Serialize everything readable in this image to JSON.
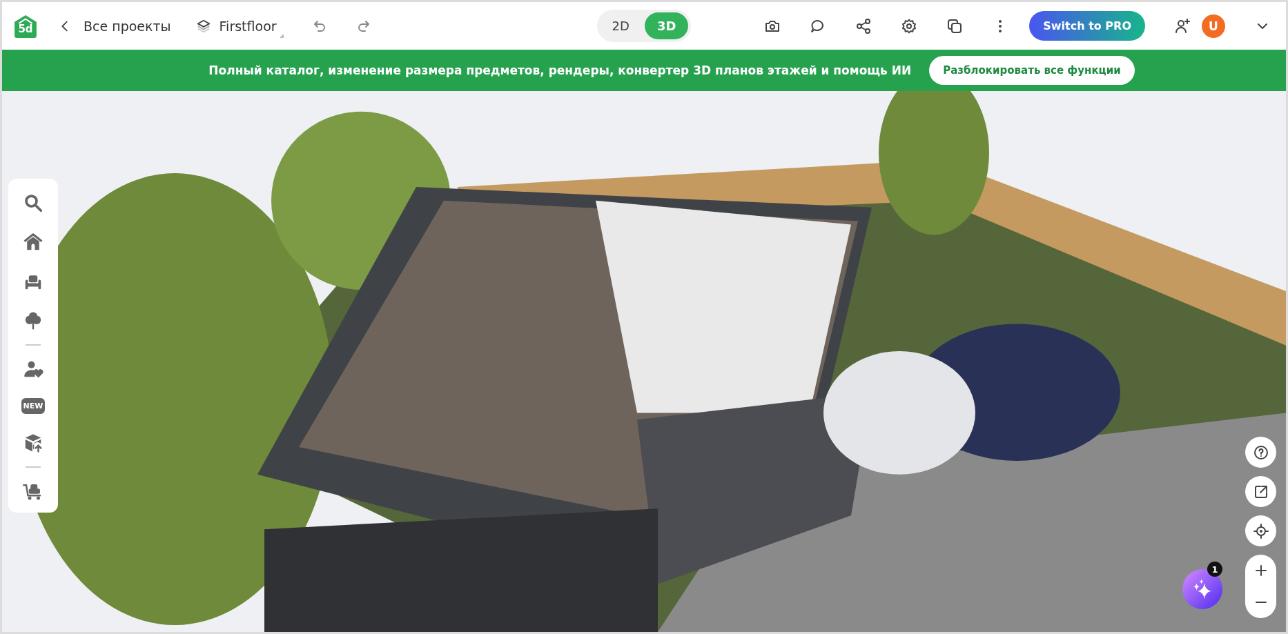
{
  "header": {
    "logo_text": "5d",
    "back_link": "Все проекты",
    "floor": "Firstfloor",
    "view_toggle": [
      {
        "label": "2D",
        "selected": false
      },
      {
        "label": "3D",
        "selected": true
      }
    ],
    "pro_button": "Switch to PRO",
    "avatar": "U"
  },
  "banner": {
    "text": "Полный каталог, изменение размера предметов, рендеры, конвертер 3D планов этажей и помощь ИИ",
    "button": "Разблокировать все функции"
  },
  "sidebar": {
    "new_badge": "NEW"
  },
  "ai_button": {
    "badge": "1"
  }
}
